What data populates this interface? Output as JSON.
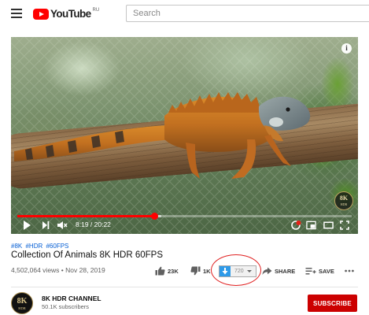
{
  "header": {
    "menu_icon": "hamburger-menu-icon",
    "logo_text": "YouTube",
    "logo_region": "RU",
    "search_placeholder": "Search"
  },
  "player": {
    "current_time": "8:19",
    "duration": "20:22",
    "time_separator": " / ",
    "progress_fraction": 0.41,
    "buffered_fraction": 0.43,
    "info_label": "i",
    "watermark_top": "8K",
    "watermark_bottom": "HDR",
    "controls": [
      "play-icon",
      "next-icon",
      "mute-icon",
      "autoplay-icon",
      "settings-icon",
      "miniplayer-icon",
      "theater-icon",
      "fullscreen-icon"
    ]
  },
  "video": {
    "hashtags": [
      "#8K",
      "#HDR",
      "#60FPS"
    ],
    "title": "Collection Of Animals 8K HDR 60FPS",
    "views": "4,502,064 views",
    "date_separator": " • ",
    "date": "Nov 28, 2019"
  },
  "actions": {
    "like_count": "23K",
    "dislike_count": "1K",
    "download_quality": "720",
    "share_label": "SHARE",
    "save_label": "SAVE",
    "more_icon": "more-horizontal-icon"
  },
  "channel": {
    "avatar_top": "8K",
    "avatar_bottom": "HDR",
    "name": "8K HDR CHANNEL",
    "subscribers": "50.1K subscribers",
    "subscribe_label": "SUBSCRIBE"
  },
  "colors": {
    "brand_red": "#ff0000",
    "subscribe_red": "#cc0000",
    "link_blue": "#065fd4",
    "download_blue": "#2e9ae8",
    "annotation_red": "#e02020"
  }
}
